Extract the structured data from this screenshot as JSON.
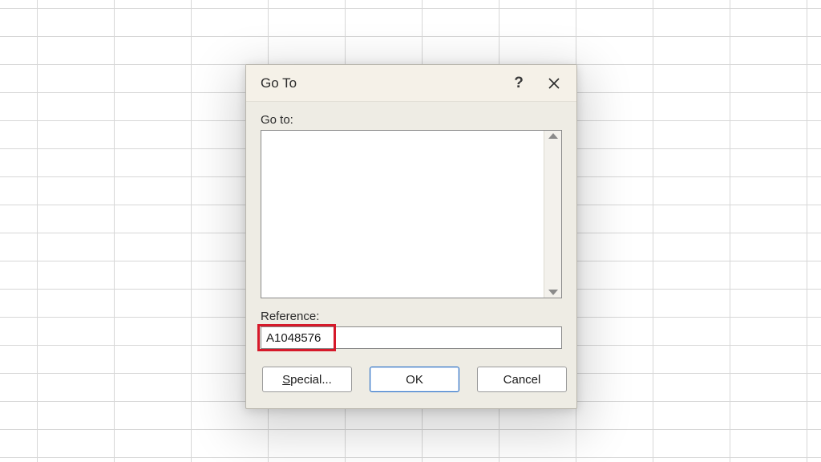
{
  "dialog": {
    "title": "Go To",
    "help_symbol": "?",
    "goto_label": "Go to:",
    "reference_label": "Reference:",
    "reference_value": "A1048576",
    "buttons": {
      "special_prefix": "S",
      "special_rest": "pecial...",
      "ok": "OK",
      "cancel": "Cancel"
    }
  }
}
